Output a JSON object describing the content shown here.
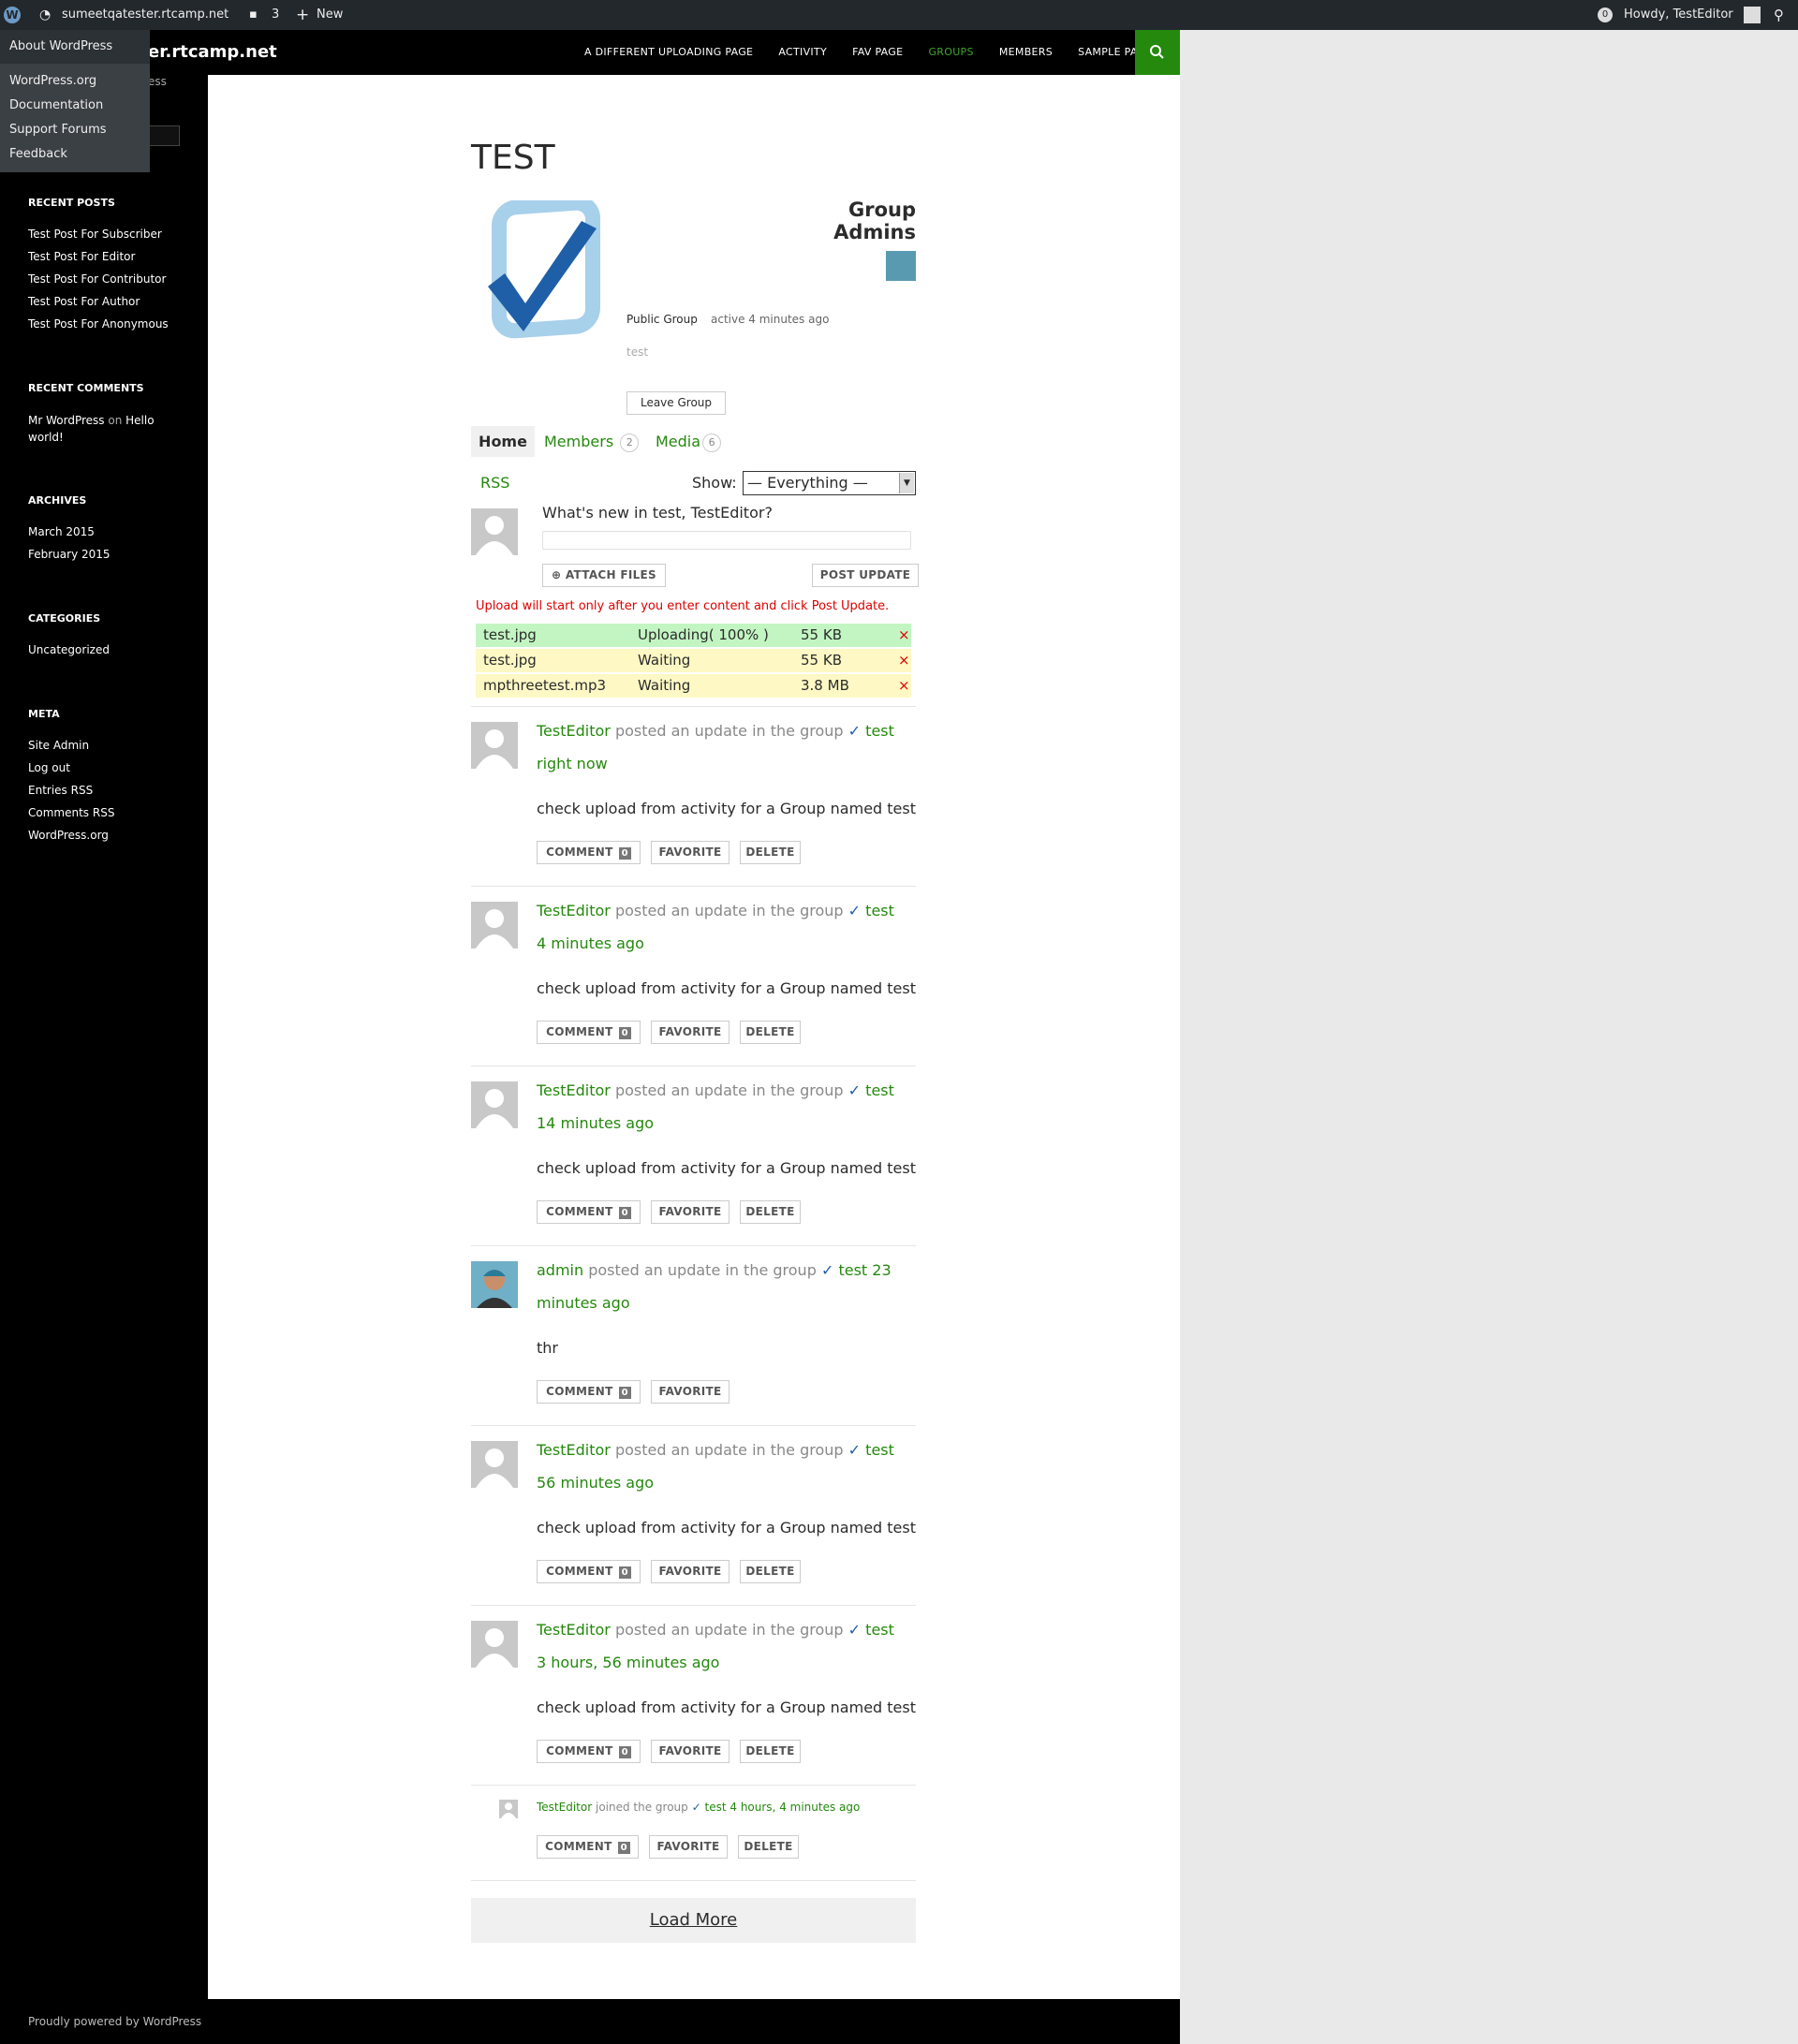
{
  "adminbar": {
    "site": "sumeetqatester.rtcamp.net",
    "comments_count": "3",
    "new_label": "New",
    "notifications": "0",
    "howdy": "Howdy, TestEditor"
  },
  "wp_menu": {
    "about": "About WordPress",
    "items": [
      "WordPress.org",
      "Documentation",
      "Support Forums",
      "Feedback"
    ]
  },
  "site": {
    "title": "er.rtcamp.net",
    "tagline": "ess"
  },
  "nav": [
    "A DIFFERENT UPLOADING PAGE",
    "ACTIVITY",
    "FAV PAGE",
    "GROUPS",
    "MEMBERS",
    "SAMPLE PAGE"
  ],
  "sidebar": {
    "recent_posts": {
      "title": "RECENT POSTS",
      "items": [
        "Test Post For Subscriber",
        "Test Post For Editor",
        "Test Post For Contributor",
        "Test Post For Author",
        "Test Post For Anonymous"
      ]
    },
    "recent_comments": {
      "title": "RECENT COMMENTS",
      "author": "Mr WordPress",
      "on": "on",
      "post": "Hello world!"
    },
    "archives": {
      "title": "ARCHIVES",
      "items": [
        "March 2015",
        "February 2015"
      ]
    },
    "categories": {
      "title": "CATEGORIES",
      "items": [
        "Uncategorized"
      ]
    },
    "meta": {
      "title": "META",
      "items": [
        "Site Admin",
        "Log out",
        "Entries RSS",
        "Comments RSS",
        "WordPress.org"
      ]
    }
  },
  "group": {
    "title": "TEST",
    "admins_label": "Group Admins",
    "type": "Public Group",
    "active": "active 4 minutes ago",
    "description": "test",
    "leave_button": "Leave Group"
  },
  "tabs": {
    "home": "Home",
    "members": "Members",
    "members_count": "2",
    "media": "Media",
    "media_count": "6"
  },
  "filter": {
    "rss": "RSS",
    "show_label": "Show:",
    "selected": "— Everything —"
  },
  "post_form": {
    "prompt": "What's new in test, TestEditor?",
    "attach": "ATTACH FILES",
    "post": "POST UPDATE",
    "upload_note": "Upload will start only after you enter content and click Post Update."
  },
  "uploads": [
    {
      "name": "test.jpg",
      "status": "Uploading( 100% )",
      "size": "55 KB",
      "remove": "×"
    },
    {
      "name": "test.jpg",
      "status": "Waiting",
      "size": "55 KB",
      "remove": "×"
    },
    {
      "name": "mpthreetest.mp3",
      "status": "Waiting",
      "size": "3.8 MB",
      "remove": "×"
    }
  ],
  "activity": [
    {
      "user": "TestEditor",
      "action": "posted an update in the group",
      "group": "test",
      "time": "right now",
      "content": "check upload from activity for a Group named test",
      "comment": "COMMENT",
      "count": "0",
      "favorite": "FAVORITE",
      "delete": "DELETE"
    },
    {
      "user": "TestEditor",
      "action": "posted an update in the group",
      "group": "test",
      "time": "4 minutes ago",
      "content": "check upload from activity for a Group named test",
      "comment": "COMMENT",
      "count": "0",
      "favorite": "FAVORITE",
      "delete": "DELETE"
    },
    {
      "user": "TestEditor",
      "action": "posted an update in the group",
      "group": "test",
      "time": "14 minutes ago",
      "content": "check upload from activity for a Group named test",
      "comment": "COMMENT",
      "count": "0",
      "favorite": "FAVORITE",
      "delete": "DELETE"
    },
    {
      "user": "admin",
      "action": "posted an update in the group",
      "group": "test 23",
      "time": "minutes ago",
      "content": "thr",
      "comment": "COMMENT",
      "count": "0",
      "favorite": "FAVORITE"
    },
    {
      "user": "TestEditor",
      "action": "posted an update in the group",
      "group": "test",
      "time": "56 minutes ago",
      "content": "check upload from activity for a Group named test",
      "comment": "COMMENT",
      "count": "0",
      "favorite": "FAVORITE",
      "delete": "DELETE"
    },
    {
      "user": "TestEditor",
      "action": "posted an update in the group",
      "group": "test",
      "time": "3 hours, 56 minutes ago",
      "content": "check upload from activity for a Group named test",
      "comment": "COMMENT",
      "count": "0",
      "favorite": "FAVORITE",
      "delete": "DELETE"
    }
  ],
  "joined": {
    "user": "TestEditor",
    "action": "joined the group",
    "group": "test",
    "time": "4 hours, 4 minutes ago",
    "comment": "COMMENT",
    "count": "0",
    "favorite": "FAVORITE",
    "delete": "DELETE"
  },
  "load_more": "Load More",
  "footer": "Proudly powered by WordPress",
  "colors": {
    "accent": "#24890d",
    "sidebar": "#000000",
    "adminbar": "#23282d",
    "upload_done": "#c2f5c2",
    "upload_waiting": "#fdf8c4",
    "error": "#e00000"
  }
}
